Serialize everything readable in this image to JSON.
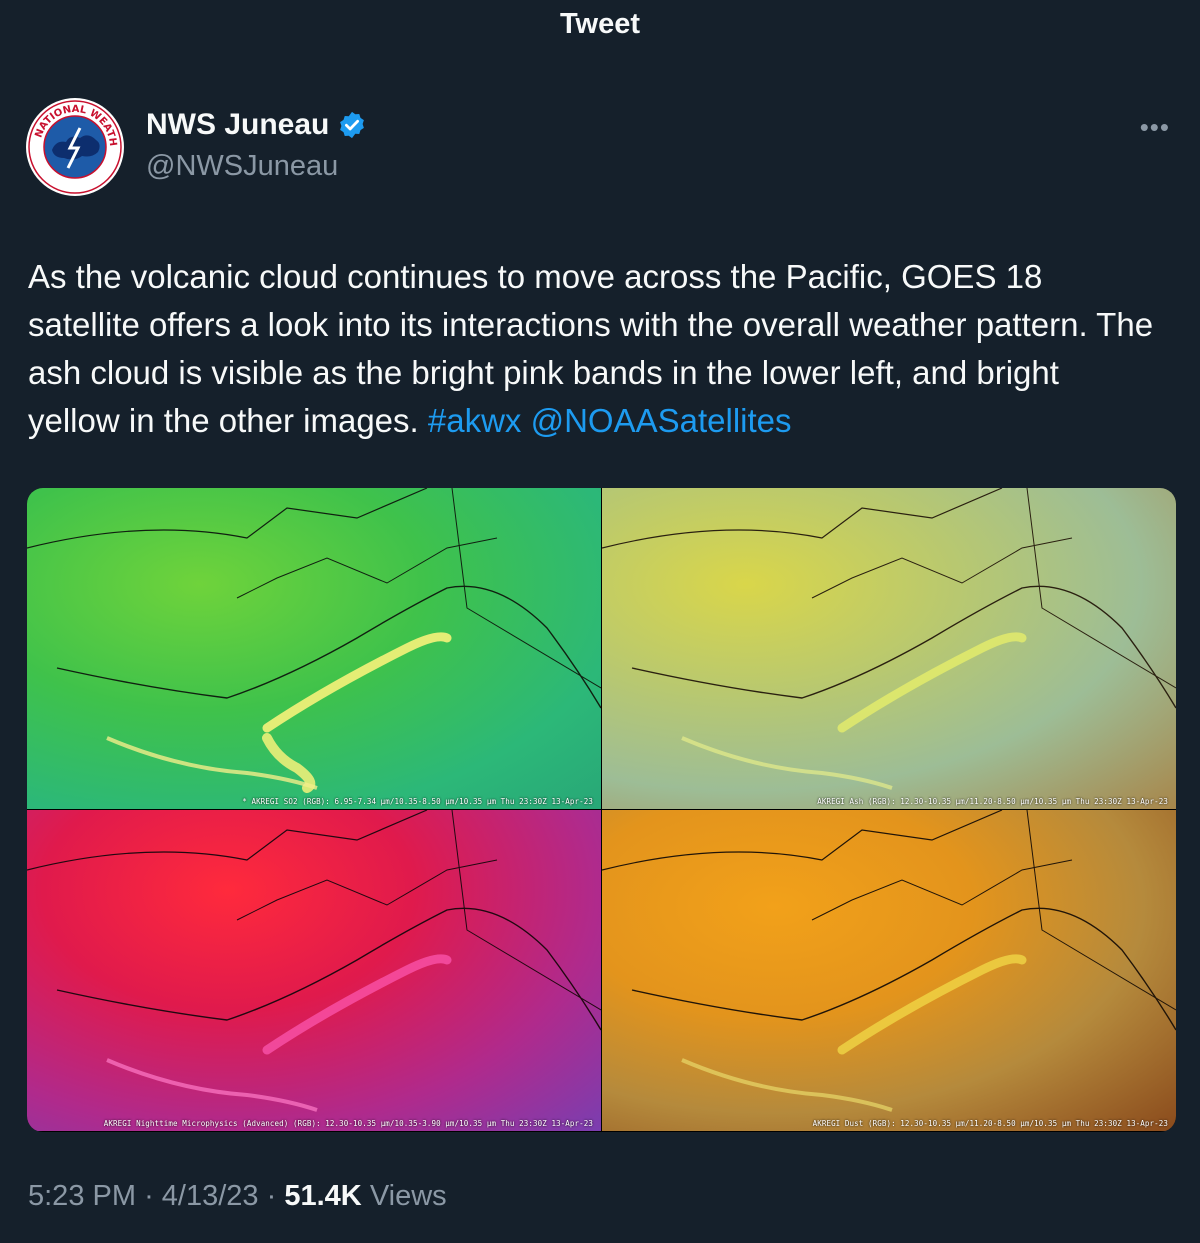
{
  "header": {
    "title": "Tweet"
  },
  "author": {
    "name": "NWS Juneau",
    "handle": "@NWSJuneau",
    "avatar_text": "NATIONAL WEATHER SERVICE",
    "verified_color": "#1d9bf0"
  },
  "tweet": {
    "text": "As the volcanic cloud continues to move across the Pacific, GOES 18 satellite offers a look into its interactions with the overall weather pattern. The ash cloud is visible as the bright pink bands in the lower left, and bright yellow in the other images.",
    "hashtag": "#akwx",
    "mention": "@NOAASatellites"
  },
  "media": {
    "panels": [
      {
        "caption": "* AKREGI SO2 (RGB): 6.95-7.34 µm/10.35-8.50 µm/10.35 µm Thu 23:30Z 13-Apr-23"
      },
      {
        "caption": "AKREGI Ash (RGB): 12.30-10.35 µm/11.20-8.50 µm/10.35 µm Thu 23:30Z 13-Apr-23"
      },
      {
        "caption": "AKREGI Nighttime Microphysics (Advanced) (RGB): 12.30-10.35 µm/10.35-3.90 µm/10.35 µm Thu 23:30Z 13-Apr-23"
      },
      {
        "caption": "AKREGI Dust (RGB): 12.30-10.35 µm/11.20-8.50 µm/10.35 µm Thu 23:30Z 13-Apr-23"
      }
    ]
  },
  "meta": {
    "time": "5:23 PM",
    "separator": "·",
    "date": "4/13/23",
    "views_count": "51.4K",
    "views_label": "Views"
  },
  "icons": {
    "more": "more-horizontal-icon",
    "verified": "verified-badge-icon"
  }
}
